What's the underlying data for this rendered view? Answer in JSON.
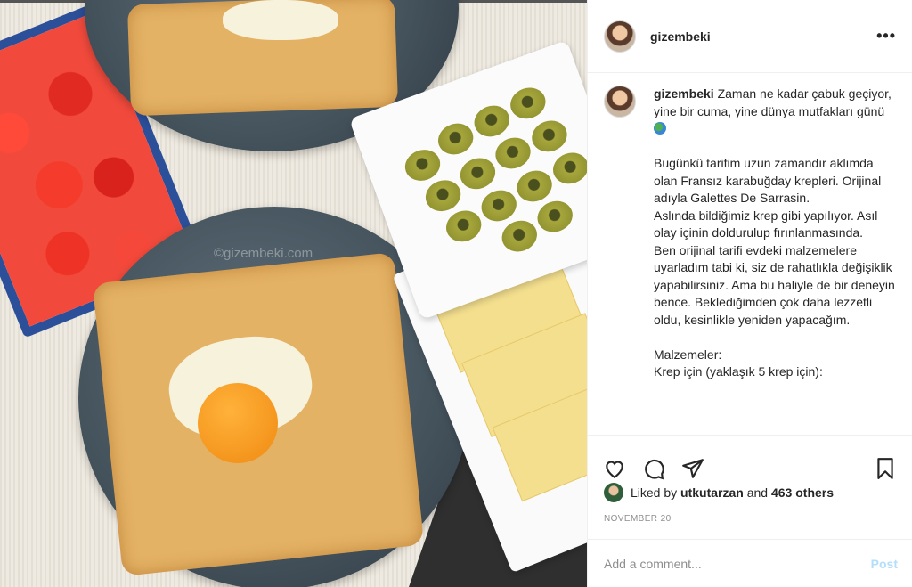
{
  "post": {
    "username": "gizembeki",
    "more_icon": "more-horizontal-icon",
    "watermark": "©gizembeki.com",
    "caption_user": "gizembeki",
    "caption_lines": [
      "Zaman ne kadar çabuk geçiyor, yine bir cuma, yine dünya mutfakları günü",
      "",
      "Bugünkü tarifim uzun zamandır aklımda olan Fransız karabuğday krepleri. Orijinal adıyla Galettes De Sarrasin.",
      "Aslında bildiğimiz krep gibi yapılıyor. Asıl olay içinin doldurulup fırınlanmasında.",
      "Ben orijinal tarifi evdeki malzemelere uyarladım tabi ki, siz de rahatlıkla değişiklik yapabilirsiniz. Ama bu haliyle de bir deneyin bence. Beklediğimden çok daha lezzetli oldu, kesinlikle yeniden yapacağım.",
      "",
      "Malzemeler:",
      "Krep için (yaklaşık 5 krep için):"
    ],
    "actions": {
      "like_icon": "heart-icon",
      "comment_icon": "comment-icon",
      "share_icon": "share-icon",
      "save_icon": "bookmark-icon"
    },
    "likes": {
      "prefix": "Liked by",
      "user": "utkutarzan",
      "and": "and",
      "others": "463 others"
    },
    "date": "NOVEMBER 20",
    "comment_placeholder": "Add a comment...",
    "post_label": "Post"
  }
}
